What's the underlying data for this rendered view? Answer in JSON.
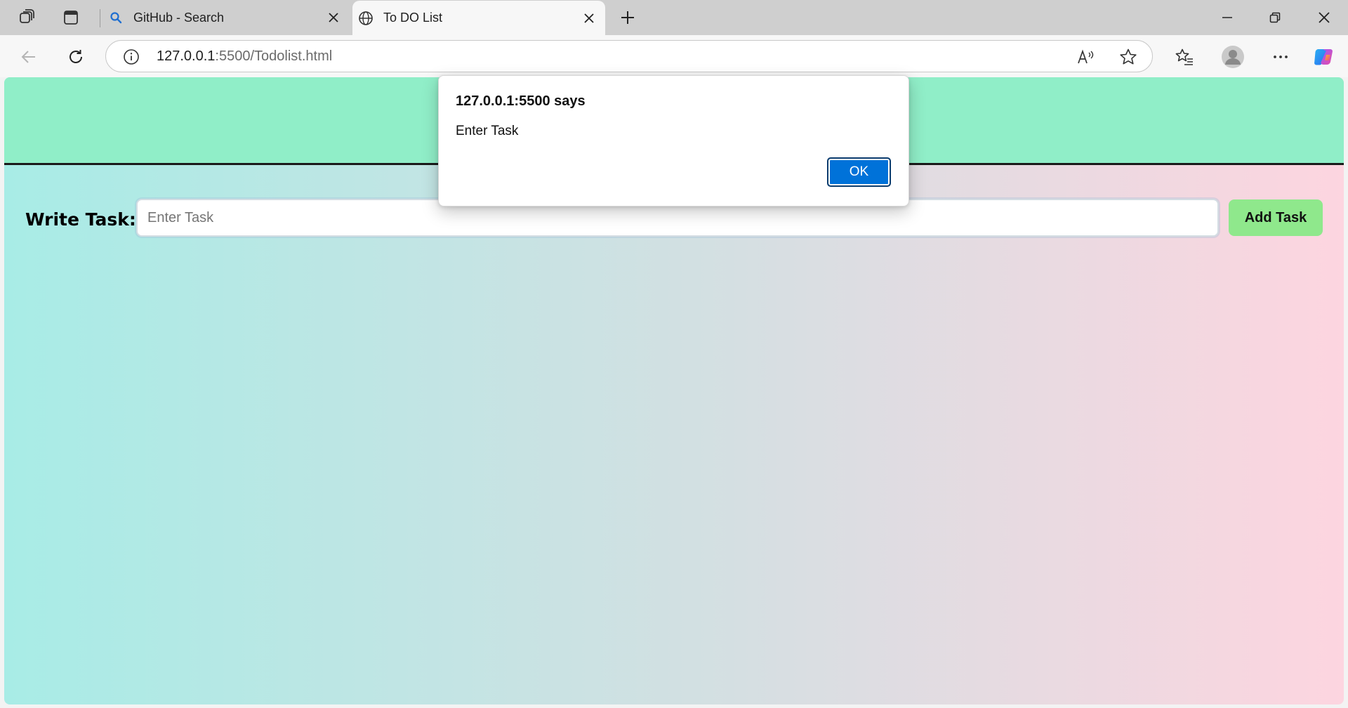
{
  "browser": {
    "tabs": [
      {
        "title": "GitHub - Search",
        "icon": "search-icon",
        "active": false
      },
      {
        "title": "To DO List",
        "icon": "globe-icon",
        "active": true
      }
    ],
    "address": {
      "host": "127.0.0.1",
      "path": ":5500/Todolist.html"
    }
  },
  "page": {
    "task_label": "Write Task:",
    "task_input_placeholder": "Enter Task",
    "task_input_value": "",
    "add_button": "Add Task",
    "colors": {
      "header": "#90eec8",
      "gradient_left": "#a8ece6",
      "gradient_right": "#fdd5e0",
      "add_button": "#8fe88c"
    }
  },
  "dialog": {
    "title": "127.0.0.1:5500 says",
    "message": "Enter Task",
    "ok_label": "OK",
    "ok_color": "#0072d9"
  }
}
